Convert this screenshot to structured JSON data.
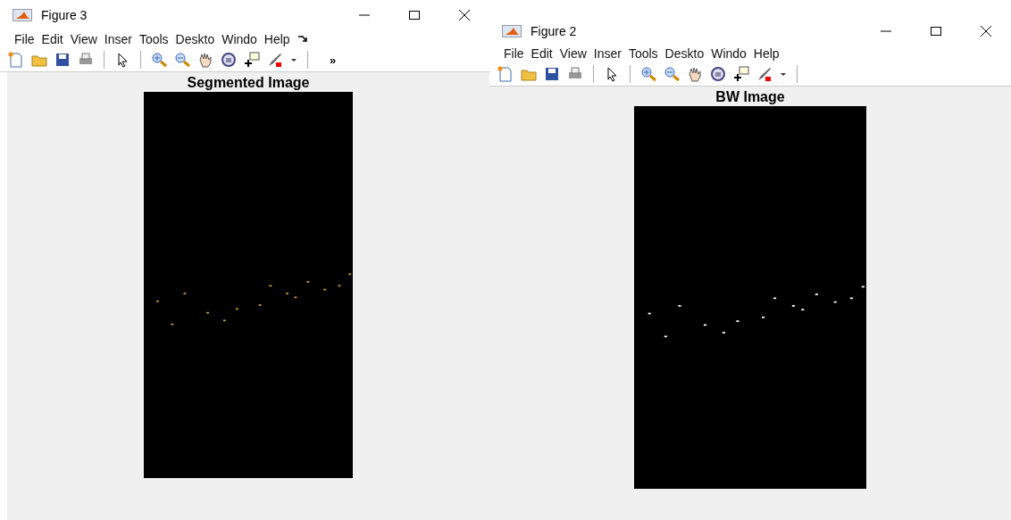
{
  "windows": [
    {
      "title": "Figure 3",
      "menu": [
        "File",
        "Edit",
        "View",
        "Inser",
        "Tools",
        "Deskto",
        "Windo",
        "Help"
      ],
      "toolbar_overflow": "»",
      "axes_title": "Segmented Image"
    },
    {
      "title": "Figure 2",
      "menu": [
        "File",
        "Edit",
        "View",
        "Inser",
        "Tools",
        "Deskto",
        "Windo",
        "Help"
      ],
      "axes_title": "BW Image"
    }
  ]
}
